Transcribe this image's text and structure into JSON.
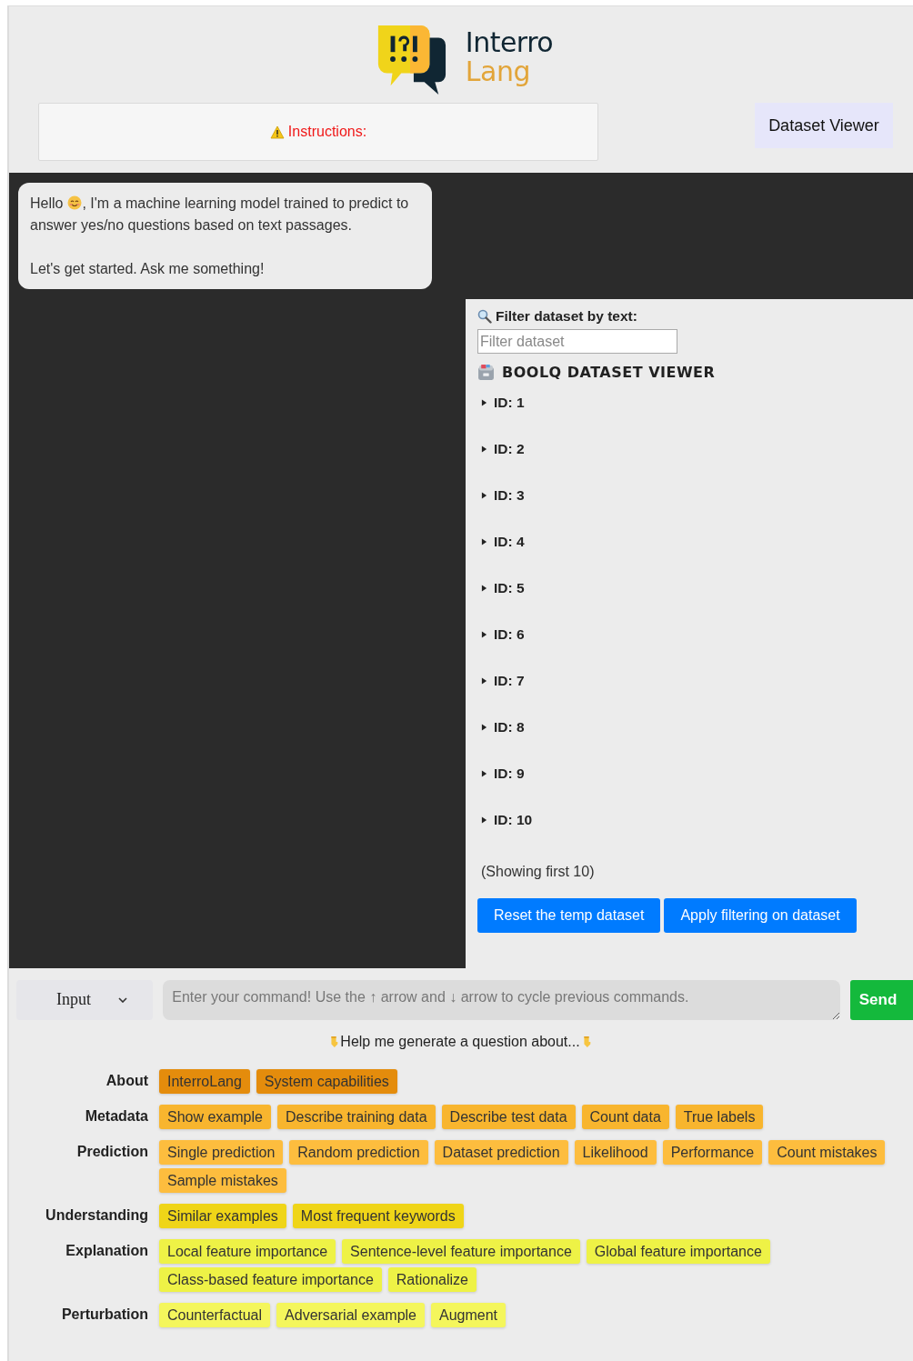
{
  "logo": {
    "line_1": "Interro",
    "line_2": "Lang"
  },
  "instructions": {
    "label": "Instructions:"
  },
  "dataset_viewer_button": "Dataset Viewer",
  "chat": [
    {
      "greeting": "Hello",
      "text_line_1": ", I'm a machine learning model trained to predict to",
      "text_line_2": "answer yes/no questions based on text passages.",
      "followup": "Let's get started. Ask me something!"
    }
  ],
  "dataset_panel": {
    "filter_label": "Filter dataset by text:",
    "filter_placeholder": "Filter dataset",
    "title": "BOOLQ DATASET VIEWER",
    "items": [
      {
        "label": "ID: 1",
        "expanded": false
      },
      {
        "label": "ID: 2",
        "expanded": false
      },
      {
        "label": "ID: 3",
        "expanded": false
      },
      {
        "label": "ID: 4",
        "expanded": false
      },
      {
        "label": "ID: 5",
        "expanded": false
      },
      {
        "label": "ID: 6",
        "expanded": false
      },
      {
        "label": "ID: 7",
        "expanded": false
      },
      {
        "label": "ID: 8",
        "expanded": false
      },
      {
        "label": "ID: 9",
        "expanded": false
      },
      {
        "label": "ID: 10",
        "expanded": false
      }
    ],
    "note": "(Showing first 10)",
    "buttons": [
      "Reset the temp dataset",
      "Apply filtering on dataset"
    ]
  },
  "input_bar": {
    "mode": "Input",
    "placeholder": "Enter your command! Use the ↑ arrow and ↓ arrow to cycle previous commands.",
    "send": "Send"
  },
  "help_line": "Help me generate a question about...",
  "categories": [
    {
      "label": "About",
      "color": "#e48c0c",
      "chips": [
        "InterroLang",
        "System capabilities"
      ]
    },
    {
      "label": "Metadata",
      "color": "#f8b52e",
      "chips": [
        "Show example",
        "Describe training data",
        "Describe test data",
        "Count data",
        "True labels"
      ]
    },
    {
      "label": "Prediction",
      "color": "#fdbd3e",
      "chips": [
        "Single prediction",
        "Random prediction",
        "Dataset prediction",
        "Likelihood",
        "Performance",
        "Count mistakes",
        "Sample mistakes"
      ]
    },
    {
      "label": "Understanding",
      "color": "#efd518",
      "chips": [
        "Similar examples",
        "Most frequent keywords"
      ]
    },
    {
      "label": "Explanation",
      "color": "#eef246",
      "chips": [
        "Local feature importance",
        "Sentence-level feature importance",
        "Global feature importance",
        "Class-based feature importance",
        "Rationalize"
      ]
    },
    {
      "label": "Perturbation",
      "color": "#f4f65c",
      "chips": [
        "Counterfactual",
        "Adversarial example",
        "Augment"
      ]
    }
  ]
}
